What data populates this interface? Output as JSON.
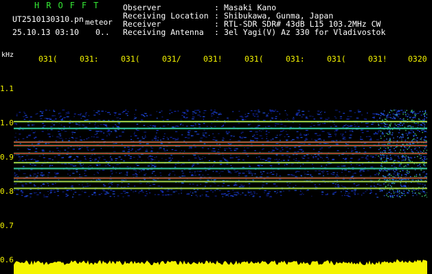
{
  "header": {
    "app_title": "HROFFT",
    "file_name": "UT2510130310.pn",
    "type_label": "meteor",
    "datetime": "25.10.13 03:10",
    "status": "0.."
  },
  "info": [
    {
      "label": "Observer",
      "value": "Masaki Kano"
    },
    {
      "label": "Receiving Location",
      "value": "Shibukawa, Gunma, Japan"
    },
    {
      "label": "Receiver",
      "value": "RTL-SDR SDR# 43dB L15 103.2MHz CW"
    },
    {
      "label": "Receiving Antenna",
      "value": "3el Yagi(V) Az 330 for Vladivostok"
    }
  ],
  "info_colon": ":",
  "y_unit": "kHz",
  "time_ticks": [
    "031(",
    "031:",
    "031(",
    "031/",
    "031!",
    "031(",
    "031:",
    "031(",
    "031!",
    "0320"
  ],
  "freq_ticks": [
    "1.1",
    "1.0",
    "0.9",
    "0.8",
    "0.7",
    "0.6"
  ],
  "colors": {
    "label_green": "#35e835",
    "text_white": "#ffffff",
    "tick_yellow": "#f4f400",
    "background": "#000000",
    "power_bar": "#f4f400",
    "noise_blue": "#1a2ac8",
    "signal_red": "#ff2020"
  },
  "chart_data": {
    "type": "heatmap",
    "x_label": "",
    "y_label": "kHz",
    "x_ticks": [
      "031(",
      "031:",
      "031(",
      "031/",
      "031!",
      "031(",
      "031:",
      "031(",
      "031!",
      "0320"
    ],
    "y_ticks": [
      1.1,
      1.0,
      0.9,
      0.8,
      0.7,
      0.6
    ],
    "ylim": [
      0.6,
      1.15
    ],
    "signal_band": [
      0.785,
      1.04
    ],
    "carriers_khz": [
      {
        "f": 1.005,
        "strength": "medium"
      },
      {
        "f": 0.985,
        "strength": "weak"
      },
      {
        "f": 0.945,
        "strength": "strong"
      },
      {
        "f": 0.935,
        "strength": "strong"
      },
      {
        "f": 0.912,
        "strength": "strong"
      },
      {
        "f": 0.885,
        "strength": "medium"
      },
      {
        "f": 0.868,
        "strength": "weak"
      },
      {
        "f": 0.84,
        "strength": "strong"
      },
      {
        "f": 0.83,
        "strength": "medium"
      },
      {
        "f": 0.81,
        "strength": "medium"
      }
    ],
    "power_trace": "continuous",
    "grid": false
  }
}
